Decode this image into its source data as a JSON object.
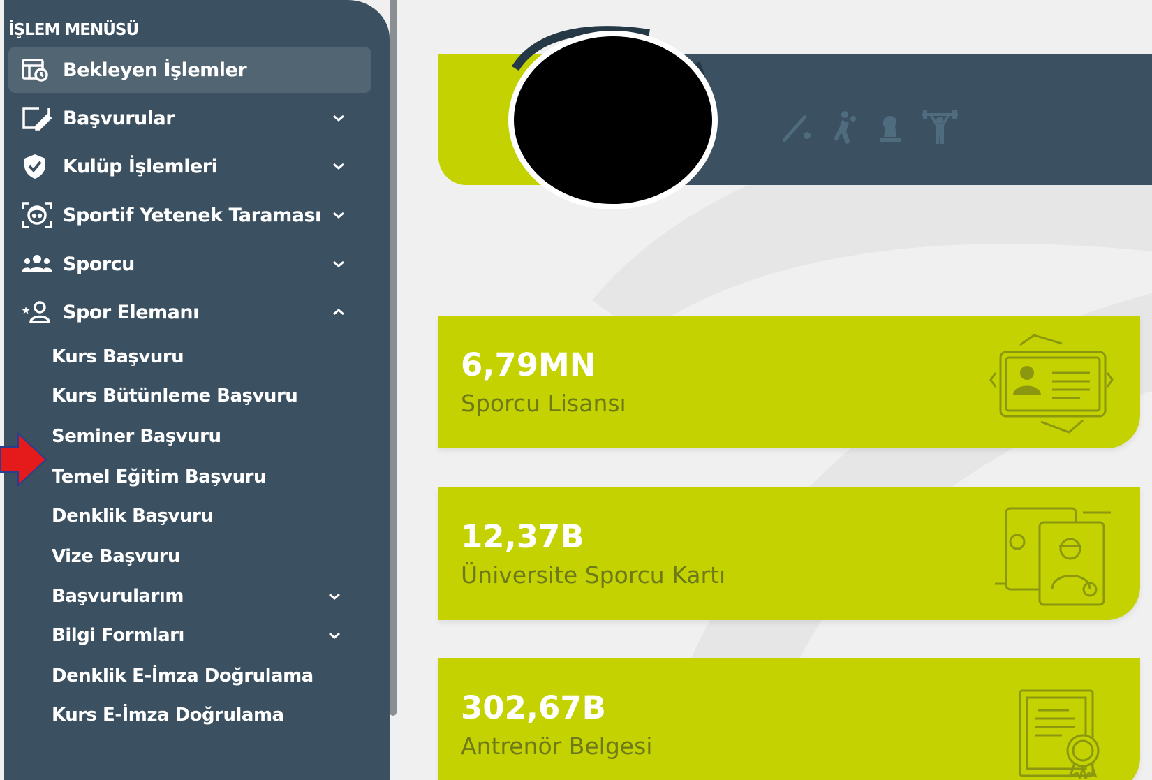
{
  "sidebar": {
    "title": "İŞLEM MENÜSÜ",
    "items": [
      {
        "label": "Bekleyen İşlemler",
        "icon": "pending-list-icon",
        "active": true
      },
      {
        "label": "Başvurular",
        "icon": "edit-form-icon",
        "chevron": "down"
      },
      {
        "label": "Kulüp İşlemleri",
        "icon": "shield-check-icon",
        "chevron": "down"
      },
      {
        "label": "Sportif Yetenek Taraması",
        "icon": "face-scan-icon",
        "chevron": "down"
      },
      {
        "label": "Sporcu",
        "icon": "users-group-icon",
        "chevron": "down"
      },
      {
        "label": "Spor Elemanı",
        "icon": "user-star-icon",
        "chevron": "up"
      }
    ],
    "subitems": [
      {
        "label": "Kurs Başvuru"
      },
      {
        "label": "Kurs Bütünleme Başvuru"
      },
      {
        "label": "Seminer Başvuru",
        "highlighted": true
      },
      {
        "label": "Temel Eğitim Başvuru"
      },
      {
        "label": "Denklik Başvuru"
      },
      {
        "label": "Vize Başvuru"
      },
      {
        "label": "Başvurularım",
        "chevron": "down"
      },
      {
        "label": "Bilgi Formları",
        "chevron": "down"
      },
      {
        "label": "Denklik E-İmza Doğrulama"
      },
      {
        "label": "Kurs E-İmza Doğrulama"
      }
    ]
  },
  "banner": {
    "sport_icons": [
      "hockey-stick-icon",
      "handball-icon",
      "chess-icon",
      "weightlifting-icon"
    ]
  },
  "stats": [
    {
      "value": "6,79MN",
      "label": "Sporcu Lisansı",
      "icon": "license-card-icon"
    },
    {
      "value": "12,37B",
      "label": "Üniversite Sporcu Kartı",
      "icon": "athlete-card-icon"
    },
    {
      "value": "302,67B",
      "label": "Antrenör Belgesi",
      "icon": "certificate-icon"
    }
  ],
  "colors": {
    "sidebar": "#3b5060",
    "accent_green": "#c3d200",
    "active_item": "#526572",
    "arrow": "#e51b1b",
    "background": "#f0f0f0"
  }
}
